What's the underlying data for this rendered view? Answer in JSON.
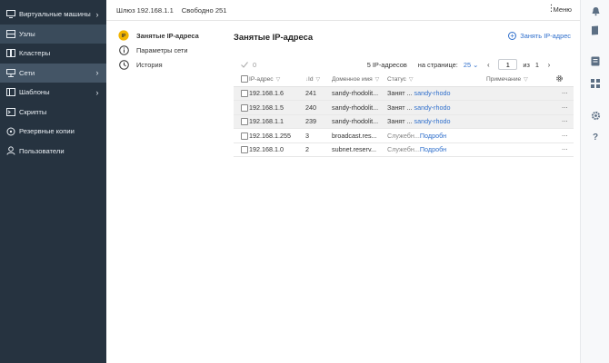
{
  "sidebar": {
    "items": [
      {
        "label": "Виртуальные машины",
        "icon": "monitor-icon",
        "chevron": "›",
        "state": "normal"
      },
      {
        "label": "Узлы",
        "icon": "node-icon",
        "chevron": "",
        "state": "active"
      },
      {
        "label": "Кластеры",
        "icon": "cluster-icon",
        "chevron": "",
        "state": "normal"
      },
      {
        "label": "Сети",
        "icon": "network-icon",
        "chevron": "›",
        "state": "active-sub"
      },
      {
        "label": "Шаблоны",
        "icon": "template-icon",
        "chevron": "›",
        "state": "normal"
      },
      {
        "label": "Скрипты",
        "icon": "script-icon",
        "chevron": "",
        "state": "normal"
      },
      {
        "label": "Резервные копии",
        "icon": "backup-icon",
        "chevron": "",
        "state": "normal"
      },
      {
        "label": "Пользователи",
        "icon": "user-icon",
        "chevron": "",
        "state": "normal"
      }
    ]
  },
  "topbar": {
    "gateway": "Шлюз 192.168.1.1",
    "free": "Свободно 251",
    "menu_label": "Меню"
  },
  "subnav": {
    "items": [
      {
        "label": "Занятые IP-адреса",
        "icon": "ip-icon",
        "active": true
      },
      {
        "label": "Параметры сети",
        "icon": "info-icon",
        "active": false
      },
      {
        "label": "История",
        "icon": "history-icon",
        "active": false
      }
    ]
  },
  "main": {
    "title": "Занятые IP-адреса",
    "occupy_button": "Занять IP-адрес",
    "selected_count": "0",
    "total": "5 IP-адресов",
    "per_page_label": "на странице:",
    "per_page_value": "25",
    "page_value": "1",
    "of_label": "из",
    "total_pages": "1"
  },
  "table": {
    "columns": [
      "IP-адрес",
      "Id",
      "Доменное имя",
      "Статус",
      "Примечание"
    ],
    "rows": [
      {
        "ip": "192.168.1.6",
        "id": "241",
        "domain": "sandy-rhodolit...",
        "status": "Занят ...",
        "status_link": "sandy-rhodo",
        "shaded": true
      },
      {
        "ip": "192.168.1.5",
        "id": "240",
        "domain": "sandy-rhodolit...",
        "status": "Занят ...",
        "status_link": "sandy-rhodo",
        "shaded": true
      },
      {
        "ip": "192.168.1.1",
        "id": "239",
        "domain": "sandy-rhodolit...",
        "status": "Занят ...",
        "status_link": "sandy-rhodo",
        "shaded": true
      },
      {
        "ip": "192.168.1.255",
        "id": "3",
        "domain": "broadcast.res...",
        "status": "Служебн...",
        "status_link": "Подробн",
        "shaded": false
      },
      {
        "ip": "192.168.1.0",
        "id": "2",
        "domain": "subnet.reserv...",
        "status": "Служебн...",
        "status_link": "Подробн",
        "shaded": false
      }
    ]
  },
  "rail": {
    "icons": [
      "notification-icon",
      "book-icon",
      "list-icon",
      "grid-icon",
      "settings-icon",
      "help-icon"
    ]
  },
  "colors": {
    "sidebar_bg": "#263340",
    "accent": "#2f6fcc",
    "ip_badge": "#f2b400"
  }
}
